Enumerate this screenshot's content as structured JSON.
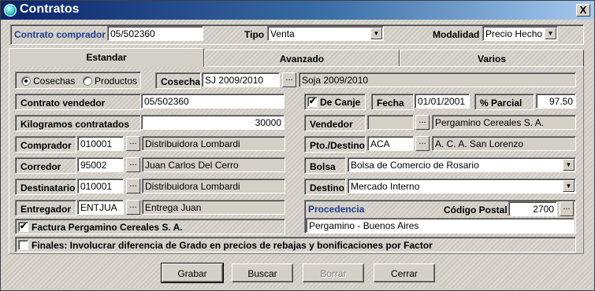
{
  "window": {
    "title": "Contratos",
    "close": "X"
  },
  "header": {
    "contrato_comprador": {
      "label": "Contrato comprador",
      "value": "05/502360"
    },
    "tipo": {
      "label": "Tipo",
      "value": "Venta"
    },
    "modalidad": {
      "label": "Modalidad",
      "value": "Precio Hecho"
    }
  },
  "tabs": [
    {
      "label": "Estandar",
      "active": true
    },
    {
      "label": "Avanzado",
      "active": false
    },
    {
      "label": "Varios",
      "active": false
    }
  ],
  "radios": {
    "cosechas": "Cosechas",
    "productos": "Productos",
    "selected": "Cosechas"
  },
  "cosecha": {
    "label": "Cosecha",
    "code": "SJ 2009/2010",
    "desc": "Soja 2009/2010",
    "button": "..."
  },
  "contrato_vendedor": {
    "label": "Contrato vendedor",
    "value": "05/502360"
  },
  "kilogramos": {
    "label": "Kilogramos contratados",
    "value": "30000"
  },
  "comprador": {
    "label": "Comprador",
    "code": "010001",
    "desc": "Distribuidora Lombardi",
    "button": "..."
  },
  "corredor": {
    "label": "Corredor",
    "code": "95002",
    "desc": "Juan Carlos Del Cerro",
    "button": "..."
  },
  "destinatario": {
    "label": "Destinatario",
    "code": "010001",
    "desc": "Distribuidora Lombardi",
    "button": "..."
  },
  "entregador": {
    "label": "Entregador",
    "code": "ENTJUA",
    "desc": "Entrega Juan",
    "button": "..."
  },
  "factura": {
    "label": "Factura Pergamino Cereales S. A.",
    "checked": true
  },
  "de_canje": {
    "label": "De Canje",
    "checked": true
  },
  "fecha": {
    "label": "Fecha",
    "value": "01/01/2001"
  },
  "parcial": {
    "label": "% Parcial",
    "value": "97.50"
  },
  "vendedor": {
    "label": "Vendedor",
    "code": "",
    "desc": "Pergamino Cereales S. A.",
    "button": "..."
  },
  "pto_destino": {
    "label": "Pto./Destino",
    "code": "ACA",
    "desc": "A. C. A. San Lorenzo",
    "button": "..."
  },
  "bolsa": {
    "label": "Bolsa",
    "value": "Bolsa de Comercio de Rosario"
  },
  "destino": {
    "label": "Destino",
    "value": "Mercado Interno"
  },
  "procedencia": {
    "label": "Procedencia",
    "value": "Pergamino - Buenos Aires"
  },
  "codigo_postal": {
    "label": "Código Postal",
    "value": "2700",
    "button": "..."
  },
  "finales": {
    "label": "Finales: Involucrar diferencia de Grado en precios de rebajas y bonificaciones por Factor",
    "checked": false
  },
  "buttons": {
    "grabar": "Grabar",
    "buscar": "Buscar",
    "borrar": "Borrar",
    "cerrar": "Cerrar"
  },
  "check_mark": "✔",
  "dropdown_glyph": "▼"
}
